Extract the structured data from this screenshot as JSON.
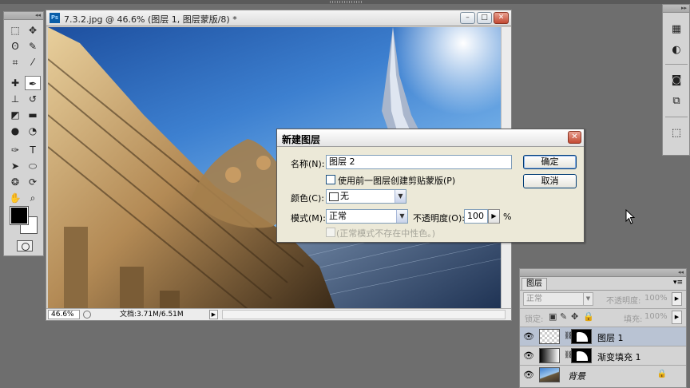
{
  "document": {
    "title": "7.3.2.jpg @ 46.6% (图层 1, 图层蒙版/8) *",
    "app_icon": "Ps",
    "zoom": "46.6%",
    "doc_size": "文档:3.71M/6.51M",
    "window_buttons": {
      "minimize": "–",
      "restore": "□",
      "close": "✕"
    }
  },
  "tools": [
    {
      "name": "marquee-tool-icon",
      "glyph": "⬚"
    },
    {
      "name": "move-tool-icon",
      "glyph": "✥"
    },
    {
      "name": "lasso-tool-icon",
      "glyph": "ʘ"
    },
    {
      "name": "quick-select-tool-icon",
      "glyph": "✎"
    },
    {
      "name": "crop-tool-icon",
      "glyph": "⌗"
    },
    {
      "name": "eyedropper-tool-icon",
      "glyph": "⁄"
    },
    {
      "name": "healing-brush-tool-icon",
      "glyph": "✚"
    },
    {
      "name": "brush-tool-icon",
      "glyph": "✒"
    },
    {
      "name": "clone-stamp-tool-icon",
      "glyph": "⊥"
    },
    {
      "name": "history-brush-tool-icon",
      "glyph": "↺"
    },
    {
      "name": "eraser-tool-icon",
      "glyph": "◩"
    },
    {
      "name": "gradient-tool-icon",
      "glyph": "▬"
    },
    {
      "name": "blur-tool-icon",
      "glyph": "●"
    },
    {
      "name": "dodge-tool-icon",
      "glyph": "◔"
    },
    {
      "name": "pen-tool-icon",
      "glyph": "✑"
    },
    {
      "name": "type-tool-icon",
      "glyph": "T"
    },
    {
      "name": "path-select-tool-icon",
      "glyph": "➤"
    },
    {
      "name": "shape-tool-icon",
      "glyph": "⬭"
    },
    {
      "name": "3d-rotate-tool-icon",
      "glyph": "❂"
    },
    {
      "name": "3d-orbit-tool-icon",
      "glyph": "⟳"
    },
    {
      "name": "hand-tool-icon",
      "glyph": "✋"
    },
    {
      "name": "zoom-tool-icon",
      "glyph": "⌕"
    }
  ],
  "right_strip": [
    {
      "name": "navigator-icon",
      "glyph": "▦"
    },
    {
      "name": "color-icon",
      "glyph": "◐"
    },
    {
      "name": "adjustments-icon",
      "glyph": "◙"
    },
    {
      "name": "masks-icon",
      "glyph": "⧉"
    },
    {
      "name": "transform-icon",
      "glyph": "⬚"
    }
  ],
  "dialog": {
    "title": "新建图层",
    "close": "✕",
    "name_label": "名称(N):",
    "name_value": "图层 2",
    "use_prev_label": "使用前一图层创建剪贴蒙版(P)",
    "color_label": "颜色(C):",
    "color_value": "无",
    "mode_label": "模式(M):",
    "mode_value": "正常",
    "opacity_label": "不透明度(O):",
    "opacity_value": "100",
    "opacity_unit": "%",
    "neutral_label": "(正常模式不存在中性色。)",
    "ok": "确定",
    "cancel": "取消"
  },
  "layers_panel": {
    "tab": "图层",
    "blend_mode": "正常",
    "opacity_label": "不透明度:",
    "opacity_value": "100%",
    "lock_label": "锁定:",
    "fill_label": "填充:",
    "fill_value": "100%",
    "layers": [
      {
        "name": "图层 1",
        "thumb": "checker",
        "selected": true
      },
      {
        "name": "渐变填充 1",
        "thumb": "grad",
        "selected": false
      },
      {
        "name": "背景",
        "thumb": "photo",
        "selected": false
      }
    ]
  }
}
